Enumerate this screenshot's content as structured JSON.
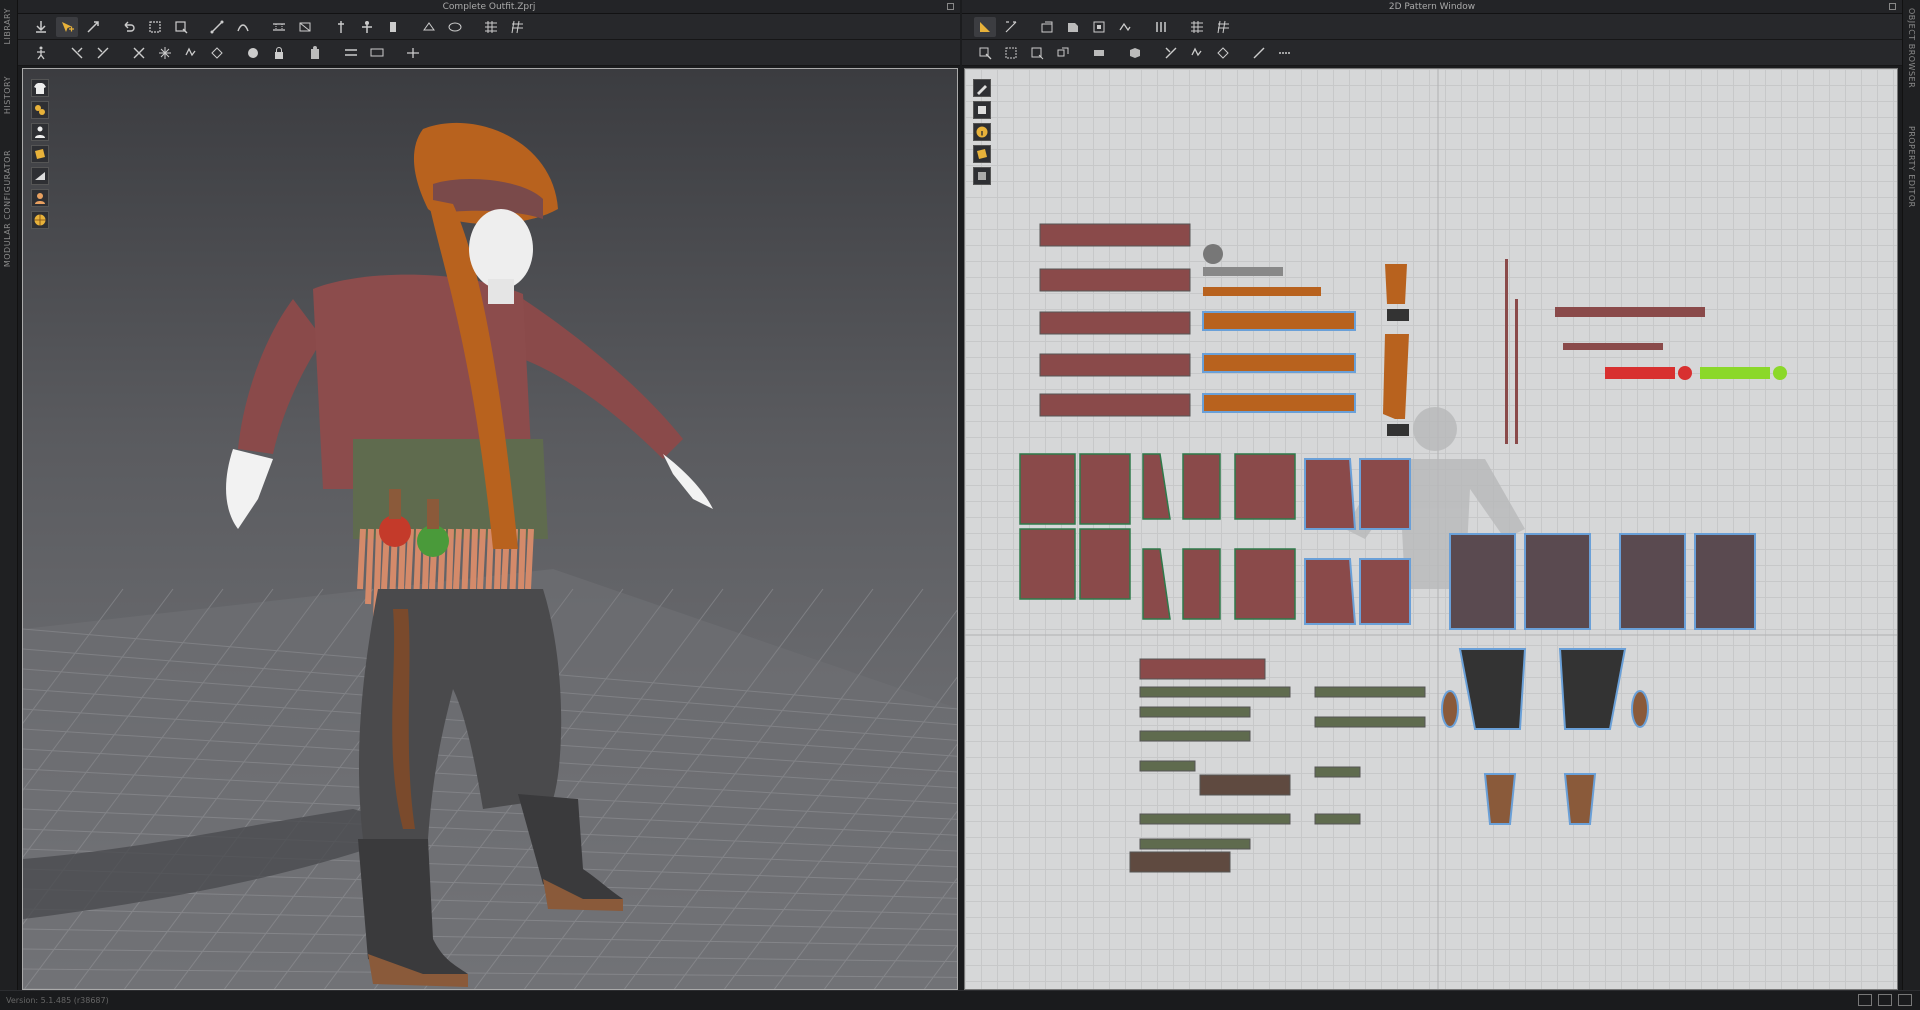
{
  "left_panel": {
    "title": "Complete Outfit.Zprj"
  },
  "right_panel": {
    "title": "2D Pattern Window"
  },
  "left_side_tabs": [
    "LIBRARY",
    "HISTORY",
    "MODULAR CONFIGURATOR"
  ],
  "right_side_tabs": [
    "OBJECT BROWSER",
    "PROPERTY EDITOR"
  ],
  "status": {
    "version": "Version: 5.1.485 (r38687)"
  },
  "colors": {
    "app_bg": "#1b1c1e",
    "toolbar_bg": "#27282b",
    "pattern_bg": "#d6d7d8",
    "fabric_red": "#8a4a4a",
    "fabric_orange": "#b8621e",
    "fabric_green": "#5f6b4e",
    "fabric_dark": "#3a3a3c",
    "leather_brown": "#7a4a2c"
  },
  "icons": {
    "left_toolbar_row1": [
      "simulation-icon",
      "select-move-icon",
      "transform-pattern-icon",
      "undo-icon",
      "redo-icon",
      "edit-pattern-icon",
      "segment-icon",
      "line-tool-icon",
      "sewing-icon",
      "fold-icon",
      "pin-icon",
      "avatar-icon",
      "tack-icon",
      "button-icon",
      "measure-icon",
      "grid-toggle-icon",
      "grid-icon"
    ],
    "left_toolbar_row2": [
      "pose-icon",
      "arrange-icon",
      "strengthen-icon",
      "deactivate-icon",
      "freeze-icon",
      "hide-icon",
      "clone-icon",
      "sphere-icon",
      "lock-icon",
      "trim-icon",
      "puckering-icon",
      "hide-3d-icon",
      "show-3d-icon"
    ],
    "right_toolbar_row1": [
      "transform-pattern-icon",
      "edit-curve-icon",
      "rectangle-icon",
      "polygon-icon",
      "internal-polygon-icon",
      "ruler-icon",
      "segment-sewing-icon",
      "grid-icon",
      "grid-toggle-icon"
    ],
    "right_toolbar_row2": [
      "select-pattern-icon",
      "edit-point-icon",
      "add-point-icon",
      "curve-point-icon",
      "trace-icon",
      "texture-icon",
      "pleat-icon",
      "fold-arrange-icon",
      "topstitch-icon",
      "grading-icon"
    ],
    "viewport3d_tools": [
      "shirt-icon",
      "fabric-render-icon",
      "avatar-display-icon",
      "texture-display-icon",
      "mesh-display-icon",
      "skin-display-icon",
      "globe-icon"
    ],
    "viewport2d_tools": [
      "pen-icon",
      "eraser-icon",
      "info-icon",
      "texture-2d-icon",
      "pattern-display-icon"
    ]
  }
}
